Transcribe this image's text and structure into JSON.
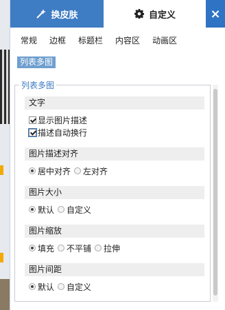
{
  "tabs": {
    "skin": "换皮肤",
    "custom": "自定义",
    "close": "×"
  },
  "subtabs": [
    "常规",
    "边框",
    "标题栏",
    "内容区",
    "动画区"
  ],
  "active_chip": "列表多图",
  "group_title": "列表多图",
  "sections": {
    "text": {
      "title": "文字",
      "options": [
        "显示图片描述",
        "描述自动换行"
      ],
      "checked": [
        true,
        true
      ]
    },
    "align": {
      "title": "图片描述对齐",
      "options": [
        "居中对齐",
        "左对齐"
      ],
      "selected": "居中对齐"
    },
    "size": {
      "title": "图片大小",
      "options": [
        "默认",
        "自定义"
      ],
      "selected": "默认"
    },
    "scale": {
      "title": "图片缩放",
      "options": [
        "填充",
        "不平铺",
        "拉伸"
      ],
      "selected": "填充"
    },
    "spacing": {
      "title": "图片间距",
      "options": [
        "默认",
        "自定义"
      ],
      "selected": "默认"
    }
  },
  "colors": {
    "accent": "#3e7cc4",
    "chip": "#6f9fcf",
    "legend": "#3a78c0"
  },
  "icons": {
    "skin": "magic-wand-icon",
    "custom": "gear-icon",
    "close": "close-icon"
  }
}
